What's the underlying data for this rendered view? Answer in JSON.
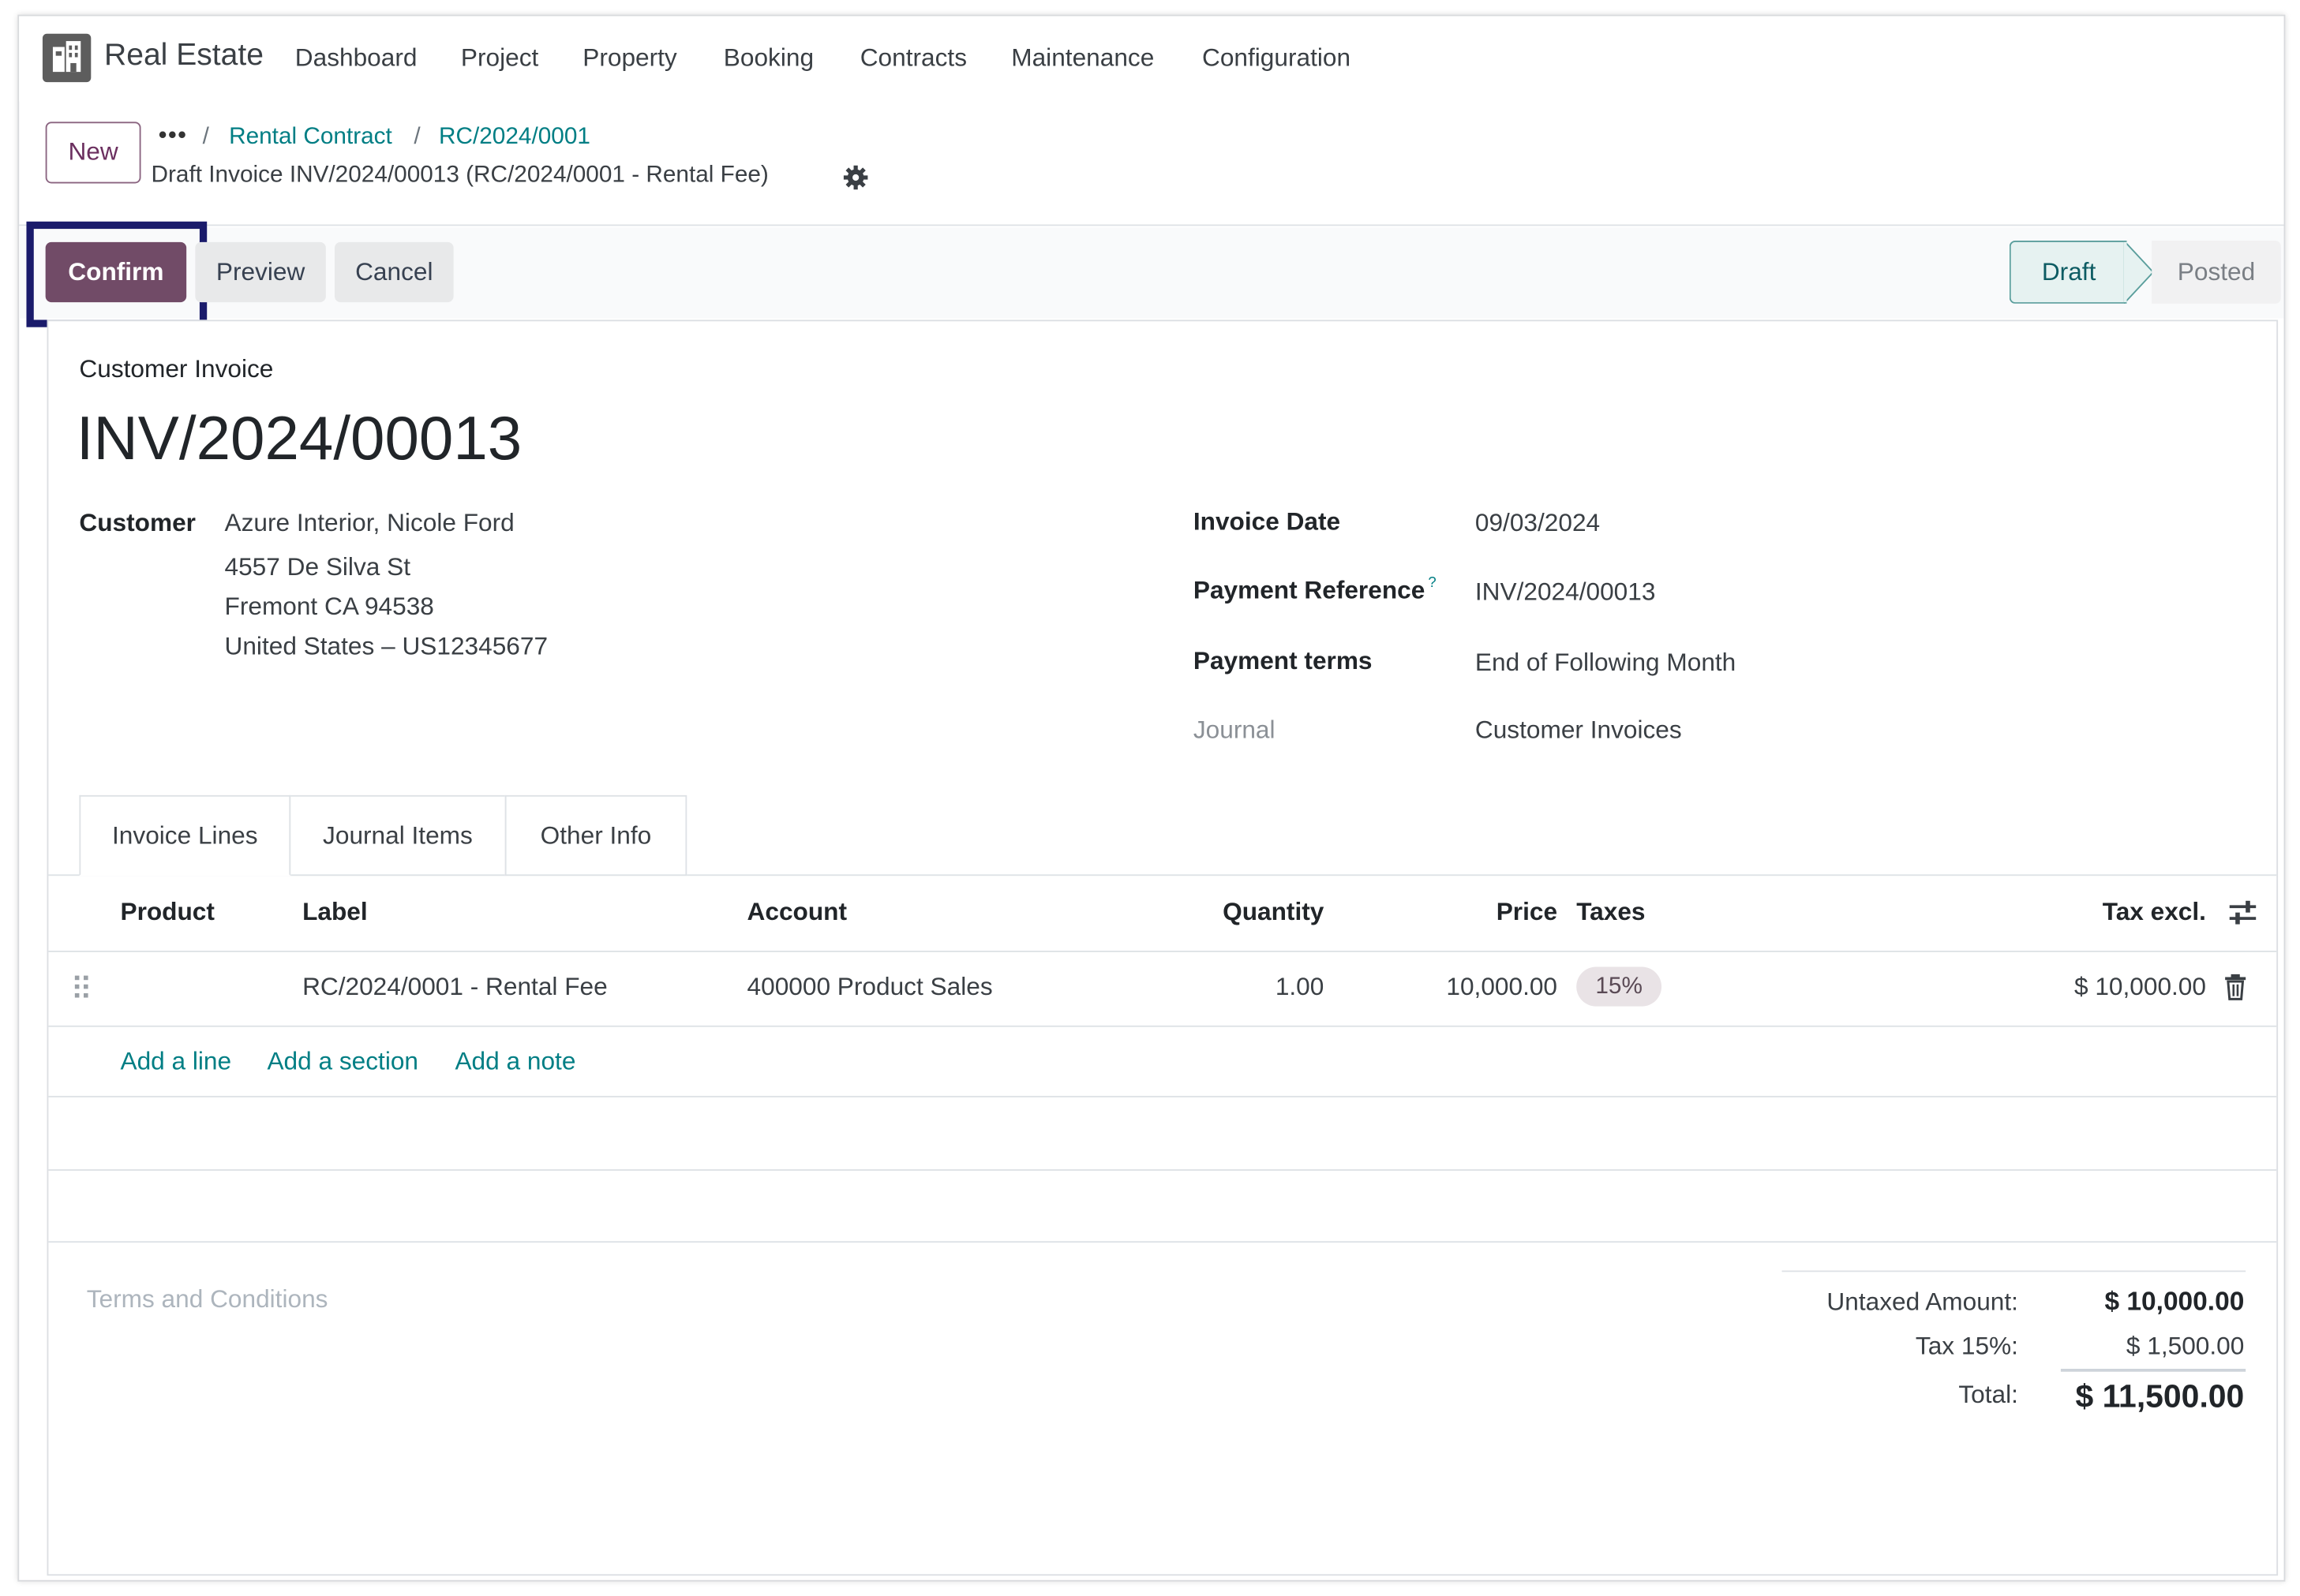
{
  "app": {
    "title": "Real Estate",
    "menu": [
      "Dashboard",
      "Project",
      "Property",
      "Booking",
      "Contracts",
      "Maintenance",
      "Configuration"
    ]
  },
  "control_panel": {
    "new_label": "New",
    "breadcrumb_more": "•••",
    "breadcrumb": [
      "Rental Contract",
      "RC/2024/0001"
    ],
    "record_title": "Draft Invoice INV/2024/00013 (RC/2024/0001 - Rental Fee)"
  },
  "actions": {
    "confirm": "Confirm",
    "preview": "Preview",
    "cancel": "Cancel"
  },
  "status": {
    "steps": [
      "Draft",
      "Posted"
    ],
    "current": "Draft"
  },
  "invoice": {
    "type": "Customer Invoice",
    "name": "INV/2024/00013",
    "customer_label": "Customer",
    "customer_lines": [
      "Azure Interior, Nicole Ford",
      "4557 De Silva St",
      "Fremont CA 94538",
      "United States – US12345677"
    ],
    "fields": [
      {
        "label": "Invoice Date",
        "value": "09/03/2024"
      },
      {
        "label": "Payment Reference",
        "value": "INV/2024/00013",
        "help": "?"
      },
      {
        "label": "Payment terms",
        "value": "End of Following Month"
      },
      {
        "label": "Journal",
        "value": "Customer Invoices"
      }
    ]
  },
  "tabs": [
    "Invoice Lines",
    "Journal Items",
    "Other Info"
  ],
  "active_tab": "Invoice Lines",
  "table": {
    "columns": [
      "Product",
      "Label",
      "Account",
      "Quantity",
      "Price",
      "Taxes",
      "Tax excl."
    ],
    "rows": [
      {
        "product": "",
        "label": "RC/2024/0001 - Rental Fee",
        "account": "400000 Product Sales",
        "quantity": "1.00",
        "price": "10,000.00",
        "taxes": "15%",
        "subtotal": "$ 10,000.00"
      }
    ],
    "add_links": [
      "Add a line",
      "Add a section",
      "Add a note"
    ]
  },
  "footer": {
    "terms_placeholder": "Terms and Conditions",
    "totals": [
      {
        "label": "Untaxed Amount:",
        "value": "$ 10,000.00"
      },
      {
        "label": "Tax 15%:",
        "value": "$ 1,500.00"
      },
      {
        "label": "Total:",
        "value": "$ 11,500.00"
      }
    ]
  },
  "colors": {
    "brand": "#714b67",
    "link": "#017e84",
    "highlight_box": "#1a1b6b"
  }
}
